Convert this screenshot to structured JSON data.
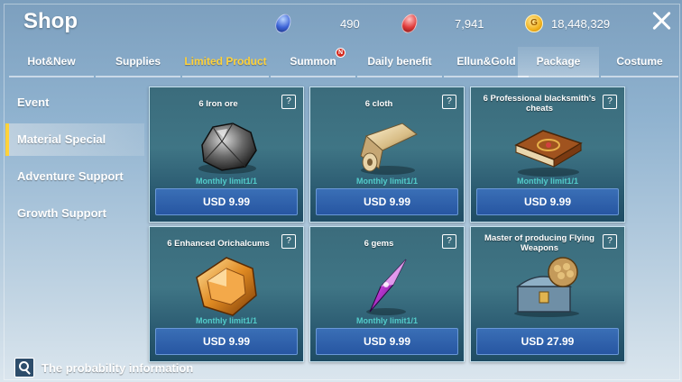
{
  "header": {
    "title": "Shop",
    "currencies": [
      {
        "icon": "blue-gem-icon",
        "amount": "490"
      },
      {
        "icon": "red-gem-icon",
        "amount": "7,941"
      },
      {
        "icon": "gold-coin-icon",
        "amount": "18,448,329",
        "coin_letter": "G"
      }
    ]
  },
  "tabs": [
    {
      "label": "Hot&New"
    },
    {
      "label": "Supplies"
    },
    {
      "label": "Limited Product",
      "highlighted": true
    },
    {
      "label": "Summon",
      "badge": "N"
    },
    {
      "label": "Daily benefit"
    },
    {
      "label": "Ellun&Gold"
    },
    {
      "label": "Package",
      "selected": true
    },
    {
      "label": "Costume"
    }
  ],
  "sidebar": {
    "items": [
      {
        "label": "Event"
      },
      {
        "label": "Material Special",
        "active": true
      },
      {
        "label": "Adventure Support"
      },
      {
        "label": "Growth Support"
      }
    ]
  },
  "products": [
    {
      "name": "6 Iron ore",
      "limit": "Monthly limit1/1",
      "price": "USD 9.99",
      "icon": "iron-ore-icon"
    },
    {
      "name": "6 cloth",
      "limit": "Monthly limit1/1",
      "price": "USD 9.99",
      "icon": "cloth-roll-icon"
    },
    {
      "name": "6 Professional blacksmith's cheats",
      "limit": "Monthly limit1/1",
      "price": "USD 9.99",
      "icon": "book-icon"
    },
    {
      "name": "6 Enhanced Orichalcums",
      "limit": "Monthly limit1/1",
      "price": "USD 9.99",
      "icon": "orichalcum-icon"
    },
    {
      "name": "6 gems",
      "limit": "Monthly limit1/1",
      "price": "USD 9.99",
      "icon": "purple-gem-icon"
    },
    {
      "name": "Master of producing Flying Weapons",
      "limit": "",
      "price": "USD 27.99",
      "icon": "treasure-chest-icon"
    }
  ],
  "help_glyph": "?",
  "footer": {
    "probability_label": "The probability information"
  },
  "colors": {
    "accent": "#ffd23a",
    "price_button": "#2f5faa",
    "limit_text": "#59ded9"
  }
}
